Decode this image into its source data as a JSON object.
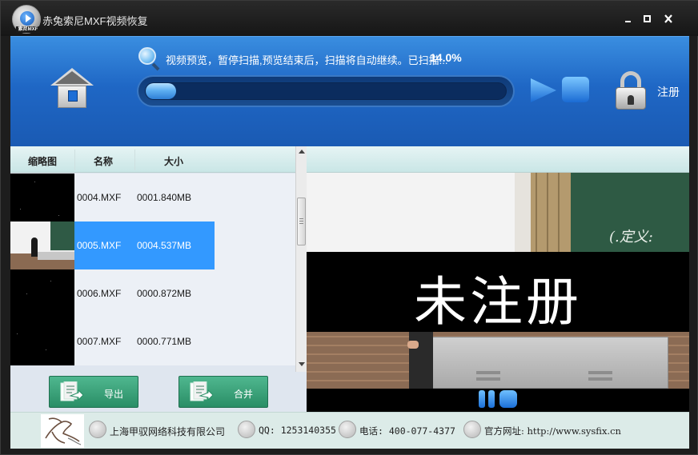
{
  "titlebar": {
    "app_badge": "索尼MXF",
    "title": "赤兔索尼MXF视频恢复",
    "minimize": "_",
    "maximize": "□",
    "close": "✕"
  },
  "header": {
    "scan_status": "视频预览，暂停扫描,预览结束后，扫描将自动继续。已扫描...",
    "scan_percent": "14.0%",
    "scan_progress": 0.14,
    "register_label": "注册"
  },
  "file_list": {
    "columns": [
      "缩略图",
      "名称",
      "大小"
    ],
    "rows": [
      {
        "name": "0004.MXF",
        "size": "0001.840MB",
        "selected": false
      },
      {
        "name": "0005.MXF",
        "size": "0004.537MB",
        "selected": true
      },
      {
        "name": "0006.MXF",
        "size": "0000.872MB",
        "selected": false
      },
      {
        "name": "0007.MXF",
        "size": "0000.771MB",
        "selected": false
      }
    ]
  },
  "actions": {
    "export_label": "导出",
    "merge_label": "合并"
  },
  "preview": {
    "watermark": "未注册",
    "chalk_text": "(.定义:"
  },
  "footer": {
    "company": "上海甲驭网络科技有限公司",
    "qq": "QQ: 1253140355",
    "phone": "电话: 400-077-4377",
    "website": "官方网址: http://www.sysfix.cn"
  },
  "colors": {
    "header_blue": "#1f67c5",
    "selected_row": "#3399ff",
    "action_green": "#2a8e66"
  }
}
